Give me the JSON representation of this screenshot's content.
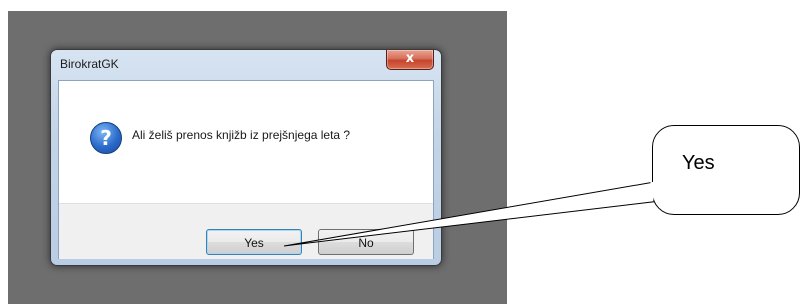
{
  "window": {
    "title": "BirokratGK",
    "close_label": "x"
  },
  "dialog": {
    "icon": "question-icon",
    "icon_glyph": "?",
    "message": "Ali želiš prenos knjižb iz prejšnjega leta ?"
  },
  "buttons": {
    "yes_label": "Yes",
    "no_label": "No"
  },
  "callout": {
    "text": "Yes"
  }
}
